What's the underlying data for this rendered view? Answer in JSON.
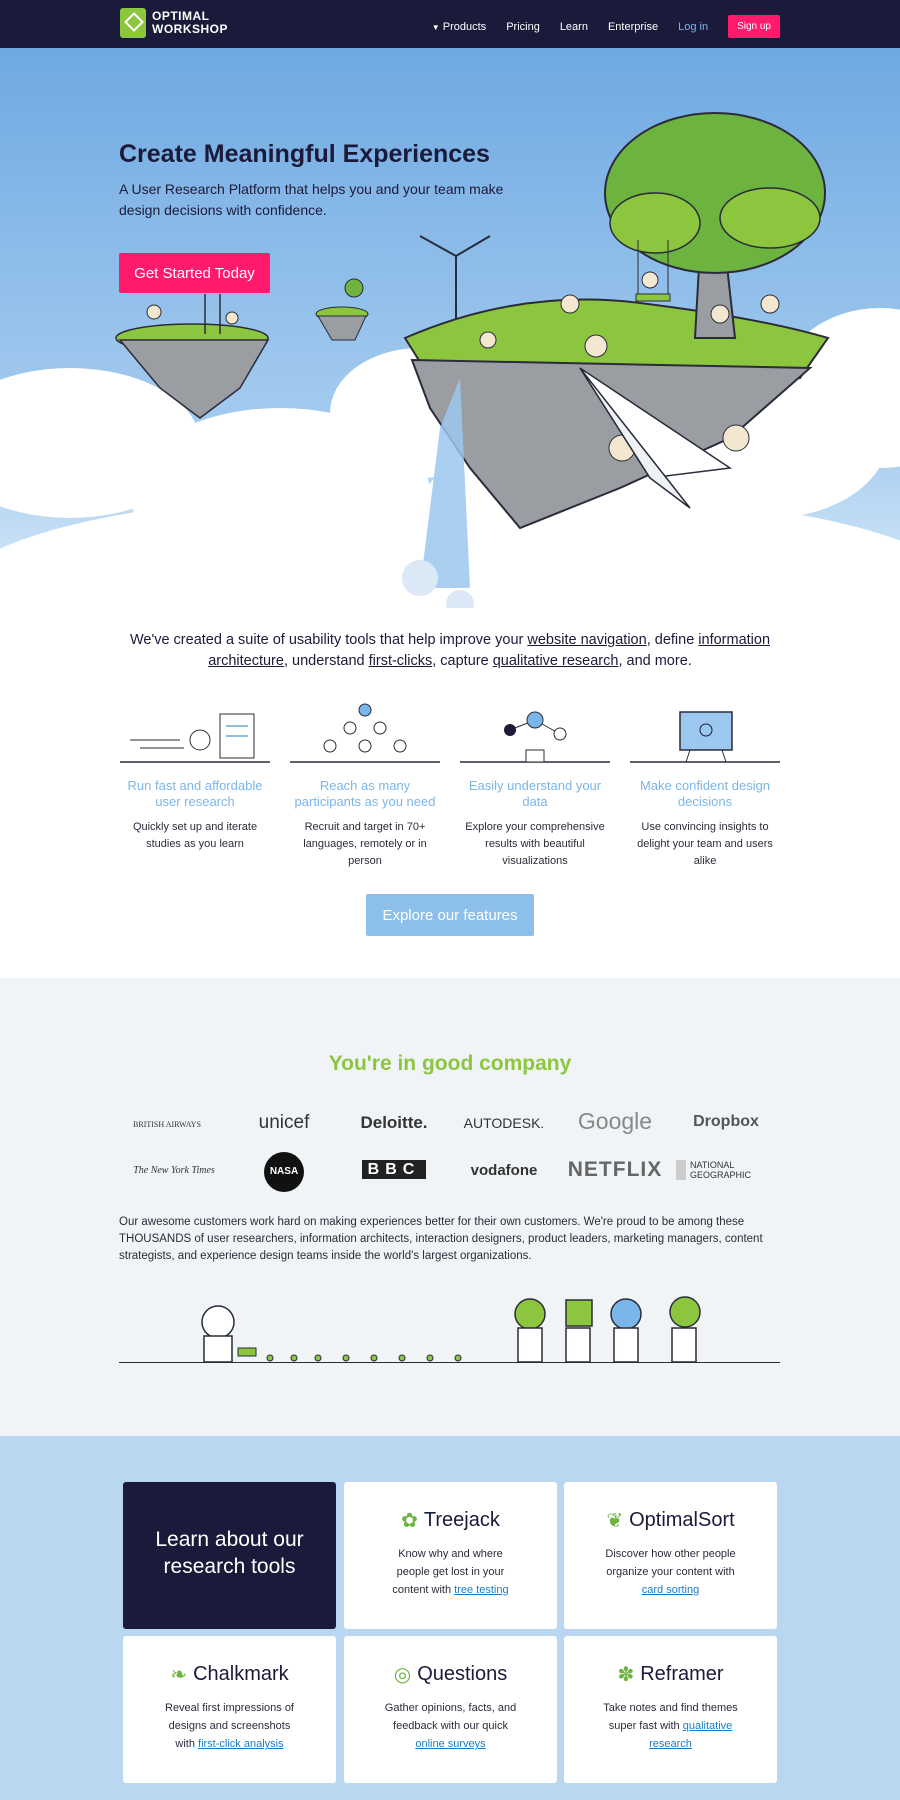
{
  "nav": {
    "logo_line1": "OPTIMAL",
    "logo_line2": "WORKSHOP",
    "products": "Products",
    "pricing": "Pricing",
    "learn": "Learn",
    "enterprise": "Enterprise",
    "login": "Log in",
    "signup": "Sign up"
  },
  "hero": {
    "title": "Create Meaningful Experiences",
    "subtitle": "A User Research Platform that helps you and your team make design decisions with confidence.",
    "cta": "Get Started Today"
  },
  "intro": {
    "t1": "We've created a suite of usability tools that help improve your ",
    "l1": "website navigation",
    "t2": ", define ",
    "l2": "information architecture",
    "t3": ", understand ",
    "l3": "first-clicks",
    "t4": ", capture ",
    "l4": "qualitative research",
    "t5": ", and more."
  },
  "features": [
    {
      "title": "Run fast and affordable user research",
      "desc": "Quickly set up and iterate studies as you learn"
    },
    {
      "title": "Reach as many participants as you need",
      "desc": "Recruit and target in 70+ languages, remotely or in person"
    },
    {
      "title": "Easily understand your data",
      "desc": "Explore your comprehensive results with beautiful visualizations"
    },
    {
      "title": "Make confident design decisions",
      "desc": "Use convincing insights to delight your team and users alike"
    }
  ],
  "explore": "Explore our features",
  "company": {
    "title": "You're in good company",
    "logos": [
      "BRITISH AIRWAYS",
      "unicef",
      "Deloitte.",
      "AUTODESK.",
      "Google",
      "Dropbox",
      "The New York Times",
      "NASA",
      "BBC",
      "vodafone",
      "NETFLIX",
      "NATIONAL GEOGRAPHIC"
    ],
    "text": "Our awesome customers work hard on making experiences better for their own customers. We're proud to be among these THOUSANDS of user researchers, information architects, interaction designers, product leaders, marketing managers, content strategists, and experience design teams inside the world's largest organizations."
  },
  "tools": {
    "headline": "Learn about our research tools",
    "cards": [
      {
        "name": "Treejack",
        "desc": "Know why and where people get lost in your content with ",
        "link": "tree testing"
      },
      {
        "name": "OptimalSort",
        "desc": "Discover how other people organize your content with ",
        "link": "card sorting"
      },
      {
        "name": "Chalkmark",
        "desc": "Reveal first impressions of designs and screenshots with ",
        "link": "first-click analysis"
      },
      {
        "name": "Questions",
        "desc": "Gather opinions, facts, and feedback with our quick ",
        "link": "online surveys"
      },
      {
        "name": "Reframer",
        "desc": "Take notes and find themes super fast with ",
        "link": "qualitative research"
      }
    ]
  }
}
